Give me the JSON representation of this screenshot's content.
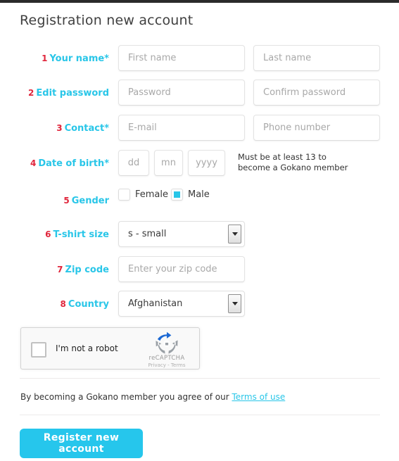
{
  "page": {
    "title": "Registration new account"
  },
  "form": {
    "rows": [
      {
        "num": "1",
        "label": "Your name*",
        "type": "two-inputs",
        "placeholder_a": "First name",
        "placeholder_b": "Last name",
        "value_a": "",
        "value_b": ""
      },
      {
        "num": "2",
        "label": "Edit password",
        "type": "two-inputs",
        "placeholder_a": "Password",
        "placeholder_b": "Confirm password",
        "value_a": "",
        "value_b": ""
      },
      {
        "num": "3",
        "label": "Contact*",
        "type": "two-inputs",
        "placeholder_a": "E-mail",
        "placeholder_b": "Phone number",
        "value_a": "",
        "value_b": ""
      },
      {
        "num": "4",
        "label": "Date of birth*",
        "type": "date",
        "placeholder_dd": "dd",
        "placeholder_mm": "mn",
        "placeholder_yyyy": "yyyy",
        "note_line1": "Must be at least 13 to",
        "note_line2": "become a Gokano member"
      },
      {
        "num": "5",
        "label": "Gender",
        "type": "checkboxes",
        "female_label": "Female",
        "female_checked": false,
        "male_label": "Male",
        "male_checked": true
      },
      {
        "num": "6",
        "label": "T-shirt size",
        "type": "select",
        "selected": "s - small"
      },
      {
        "num": "7",
        "label": "Zip code",
        "type": "input",
        "placeholder": "Enter your zip code",
        "value": ""
      },
      {
        "num": "8",
        "label": "Country",
        "type": "select",
        "selected": "Afghanistan"
      }
    ]
  },
  "recaptcha": {
    "checkbox_label": "I'm not a robot",
    "brand": "reCAPTCHA",
    "links": "Privacy - Terms",
    "checked": false
  },
  "footer": {
    "terms_prefix": "By becoming a Gokano member you agree of our ",
    "terms_link": "Terms of use",
    "submit_label": "Register new account"
  },
  "colors": {
    "accent": "#29c6e8",
    "number": "#e0263c",
    "button": "#26c6ec",
    "topbar": "#2b2b2b"
  }
}
